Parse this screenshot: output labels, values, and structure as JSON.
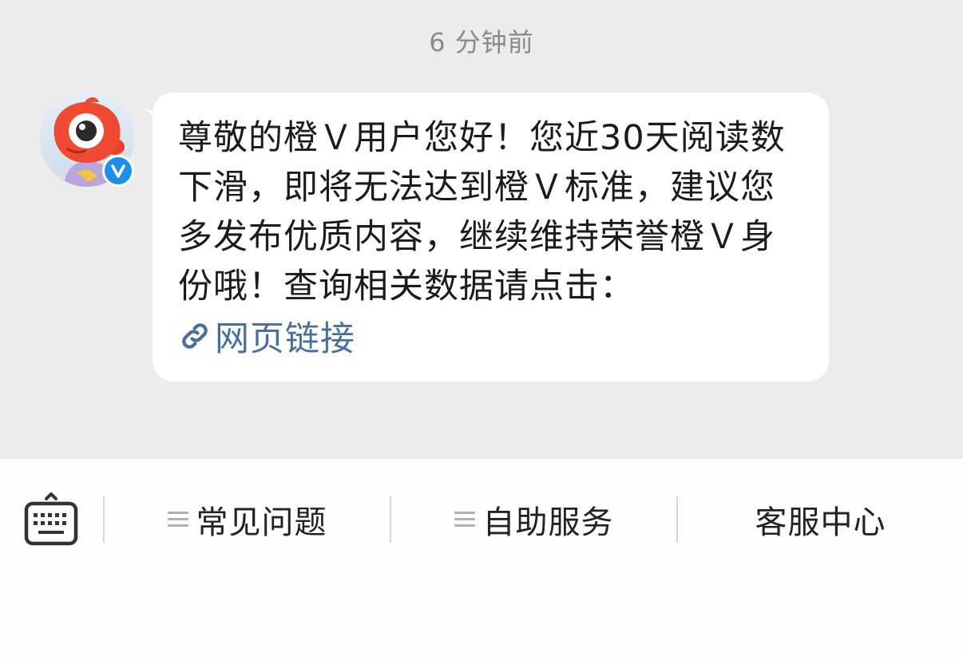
{
  "chat": {
    "timestamp": "6 分钟前",
    "sender": {
      "avatar_icon": "mascot-avatar",
      "badge_icon": "verified-v-icon",
      "badge_color": "#1e8ee8"
    },
    "message": {
      "text": "尊敬的橙Ｖ用户您好！您近30天阅读数下滑，即将无法达到橙Ｖ标准，建议您多发布优质内容，继续维持荣誉橙Ｖ身份哦！查询相关数据请点击：",
      "link_icon": "link-icon",
      "link_label": "网页链接",
      "link_color": "#4a6f9c"
    }
  },
  "bottom_bar": {
    "keyboard_icon": "keyboard-icon",
    "menu": [
      {
        "label": "常见问题",
        "icon": "menu-lines-icon"
      },
      {
        "label": "自助服务",
        "icon": "menu-lines-icon"
      },
      {
        "label": "客服中心"
      }
    ]
  }
}
